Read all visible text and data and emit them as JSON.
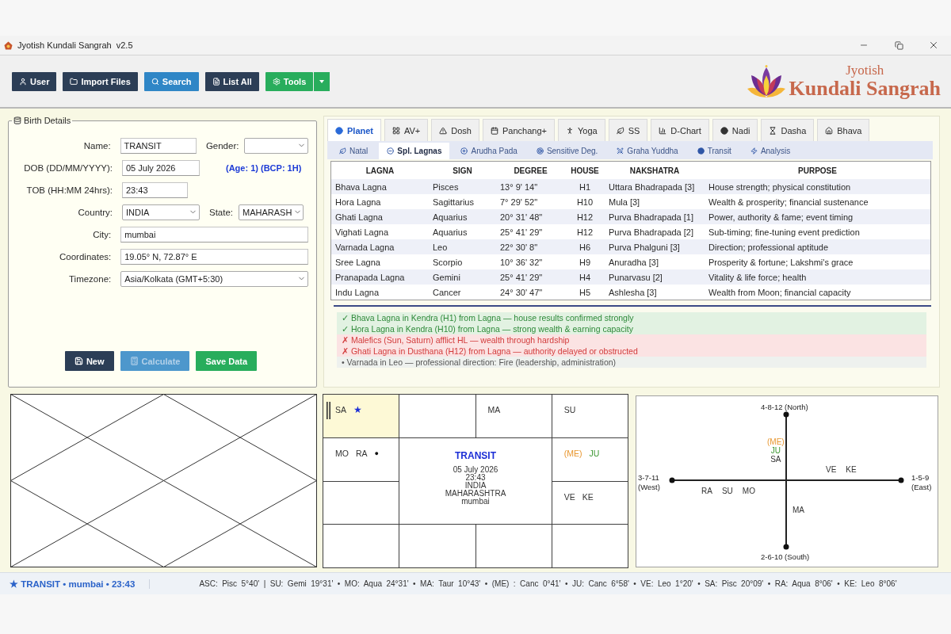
{
  "window": {
    "title": "Jyotish Kundali Sangrah  v2.5"
  },
  "toolbar": [
    {
      "label": "User",
      "kind": "dark",
      "split": false
    },
    {
      "label": "Import Files",
      "kind": "dark",
      "split": false
    },
    {
      "label": "Search",
      "kind": "blue",
      "split": false
    },
    {
      "label": "List All",
      "kind": "dark",
      "split": false
    },
    {
      "label": "Tools",
      "kind": "green",
      "split": true
    }
  ],
  "logo": {
    "small": "Jyotish",
    "large": "Kundali Sangrah"
  },
  "birth_details": {
    "title": "Birth Details",
    "rows": [
      {
        "fields": [
          {
            "label": "Name:",
            "kind": "input",
            "value": "TRANSIT"
          },
          {
            "label": "Gender:",
            "kind": "select"
          }
        ]
      },
      {
        "fields": [
          {
            "label": "DOB (DD/MM/YYYY):",
            "kind": "input",
            "value": "05 July 2026"
          }
        ],
        "note": "(Age: 1) (BCP: 1H)"
      },
      {
        "fields": [
          {
            "label": "TOB (HH:MM 24hrs):",
            "kind": "input",
            "value": "23:43"
          }
        ]
      },
      {
        "fields": [
          {
            "label": "Country:",
            "kind": "select",
            "value": "INDIA"
          },
          {
            "label": "State:",
            "kind": "select",
            "value": "MAHARASH"
          }
        ]
      },
      {
        "fields": [
          {
            "label": "City:",
            "kind": "input",
            "value": "mumbai"
          }
        ]
      },
      {
        "fields": [
          {
            "label": "Coordinates:",
            "kind": "input",
            "value": "19.05° N, 72.87° E"
          }
        ]
      },
      {
        "fields": [
          {
            "label": "Timezone:",
            "kind": "select",
            "value": "Asia/Kolkata (GMT+5:30)"
          }
        ]
      }
    ],
    "buttons": [
      {
        "label": "New",
        "kind": "dark",
        "disabled": false
      },
      {
        "label": "Calculate",
        "kind": "blue",
        "disabled": true
      },
      {
        "label": "Save Data",
        "kind": "green",
        "disabled": false
      }
    ]
  },
  "tabs": [
    {
      "label": "Planet",
      "selected": true
    },
    {
      "label": "AV+",
      "selected": false
    },
    {
      "label": "Dosh",
      "selected": false
    },
    {
      "label": "Panchang+",
      "selected": false
    },
    {
      "label": "Yoga",
      "selected": false
    },
    {
      "label": "SS",
      "selected": false
    },
    {
      "label": "D-Chart",
      "selected": false
    },
    {
      "label": "Nadi",
      "selected": false
    },
    {
      "label": "Dasha",
      "selected": false
    },
    {
      "label": "Bhava",
      "selected": false
    }
  ],
  "sub_tabs": [
    {
      "label": "Natal",
      "selected": false
    },
    {
      "label": "Spl. Lagnas",
      "selected": true
    },
    {
      "label": "Arudha Pada",
      "selected": false
    },
    {
      "label": "Sensitive Deg.",
      "selected": false
    },
    {
      "label": "Graha Yuddha",
      "selected": false
    },
    {
      "label": "Transit",
      "selected": false
    },
    {
      "label": "Analysis",
      "selected": false
    }
  ],
  "lagna_table": {
    "columns": [
      "LAGNA",
      "SIGN",
      "DEGREE",
      "HOUSE",
      "NAKSHATRA",
      "PURPOSE"
    ],
    "rows": [
      [
        "Bhava Lagna",
        "Pisces",
        "13° 9' 14\"",
        "H1",
        "Uttara Bhadrapada [3]",
        "House strength; physical constitution"
      ],
      [
        "Hora Lagna",
        "Sagittarius",
        "7° 29' 52\"",
        "H10",
        "Mula [3]",
        "Wealth & prosperity; financial sustenance"
      ],
      [
        "Ghati Lagna",
        "Aquarius",
        "20° 31' 48\"",
        "H12",
        "Purva Bhadrapada [1]",
        "Power, authority & fame; event timing"
      ],
      [
        "Vighati Lagna",
        "Aquarius",
        "25° 41' 29\"",
        "H12",
        "Purva Bhadrapada [2]",
        "Sub-timing; fine-tuning event prediction"
      ],
      [
        "Varnada Lagna",
        "Leo",
        "22° 30' 8\"",
        "H6",
        "Purva Phalguni [3]",
        "Direction; professional aptitude"
      ],
      [
        "Sree Lagna",
        "Scorpio",
        "10° 36' 32\"",
        "H9",
        "Anuradha [3]",
        "Prosperity & fortune; Lakshmi's grace"
      ],
      [
        "Pranapada Lagna",
        "Gemini",
        "25° 41' 29\"",
        "H4",
        "Punarvasu [2]",
        "Vitality & life force; health"
      ],
      [
        "Indu Lagna",
        "Cancer",
        "24° 30' 47\"",
        "H5",
        "Ashlesha [3]",
        "Wealth from Moon; financial capacity"
      ]
    ]
  },
  "notes": [
    {
      "kind": "good",
      "mark": "✓",
      "text": "Bhava Lagna in Kendra (H1) from Lagna — house results confirmed strongly"
    },
    {
      "kind": "good",
      "mark": "✓",
      "text": "Hora Lagna in Kendra (H10) from Lagna — strong wealth & earning capacity"
    },
    {
      "kind": "bad",
      "mark": "✗",
      "text": "Malefics (Sun, Saturn) afflict HL — wealth through hardship"
    },
    {
      "kind": "bad",
      "mark": "✗",
      "text": "Ghati Lagna in Dusthana (H12) from Lagna — authority delayed or obstructed"
    },
    {
      "kind": "info",
      "mark": "•",
      "text": "Varnada in Leo — professional direction: Fire (leadership, administration)"
    }
  ],
  "south_chart": {
    "title": "TRANSIT",
    "details": [
      "05 July 2026",
      "23:43",
      "INDIA",
      "MAHARASHTRA",
      "mumbai"
    ],
    "houses": [
      {
        "ascendant": true,
        "planets": [
          {
            "kind": "planet",
            "text": "SA",
            "color": "#333333"
          },
          {
            "kind": "star",
            "text": "★",
            "color": "#1c2fd6"
          }
        ]
      },
      {
        "ascendant": false
      },
      {
        "ascendant": false,
        "planets": [
          {
            "kind": "planet",
            "text": "MA",
            "color": "#333333"
          }
        ]
      },
      {
        "ascendant": false,
        "planets": [
          {
            "kind": "planet",
            "text": "SU",
            "color": "#333333"
          }
        ]
      },
      {
        "ascendant": false,
        "planets": [
          {
            "kind": "planet",
            "text": "(ME)",
            "color": "#e8962e"
          },
          {
            "kind": "planet",
            "text": "JU",
            "color": "#3a9630"
          }
        ]
      },
      {
        "ascendant": false,
        "planets": [
          {
            "kind": "planet",
            "text": "VE",
            "color": "#333333"
          },
          {
            "kind": "planet",
            "text": "KE",
            "color": "#333333"
          }
        ]
      },
      {
        "ascendant": false
      },
      {
        "ascendant": false
      },
      {
        "ascendant": false
      },
      {
        "ascendant": false
      },
      {
        "ascendant": false
      },
      {
        "ascendant": false,
        "planets": [
          {
            "kind": "planet",
            "text": "MO",
            "color": "#333333"
          },
          {
            "kind": "planet",
            "text": "RA",
            "color": "#333333"
          },
          {
            "kind": "dot",
            "text": "●",
            "color": "#111111"
          }
        ]
      }
    ]
  },
  "cross_chart": {
    "north": "4-8-12 (North)",
    "south": "2-6-10 (South)",
    "west": [
      "3-7-11",
      "(West)"
    ],
    "east": [
      "1-5-9",
      "(East)"
    ],
    "groups": [
      {
        "kind": "north",
        "planets": [
          {
            "text": "(ME)",
            "color": "#e8962e"
          },
          {
            "text": "JU",
            "color": "#3a9630"
          },
          {
            "text": "SA",
            "color": "#333333"
          }
        ]
      },
      {
        "kind": "east",
        "planets": [
          {
            "text": "VE",
            "color": "#333333"
          },
          {
            "text": "KE",
            "color": "#333333"
          }
        ]
      },
      {
        "kind": "west",
        "planets": [
          {
            "text": "RA",
            "color": "#333333"
          },
          {
            "text": "SU",
            "color": "#333333"
          },
          {
            "text": "MO",
            "color": "#333333"
          }
        ]
      },
      {
        "kind": "south",
        "planets": [
          {
            "text": "MA",
            "color": "#333333"
          }
        ]
      }
    ]
  },
  "status_bar": {
    "summary": "★ TRANSIT • mumbai • 23:43",
    "positions": "ASC: Pisc 5°40' | SU: Gemi 19°31' • MO: Aqua 24°31' • MA: Taur 10°43' • (ME) : Canc 0°41' • JU: Canc 6°58' • VE: Leo 1°20' • SA: Pisc 20°09' • RA: Aqua 8°06' • KE: Leo 8°06'"
  }
}
